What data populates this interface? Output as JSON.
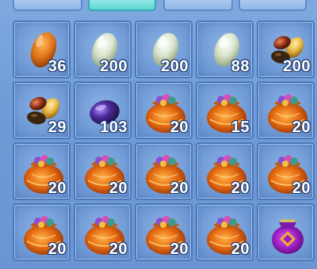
{
  "tabs": [
    {
      "label": "",
      "active": false
    },
    {
      "label": "",
      "active": true
    },
    {
      "label": "",
      "active": false
    },
    {
      "label": "",
      "active": false
    }
  ],
  "inventory": {
    "slots": [
      {
        "icon": "orange-bean-icon",
        "qty": "36"
      },
      {
        "icon": "white-bean-icon",
        "qty": "200"
      },
      {
        "icon": "white-bean-icon",
        "qty": "200"
      },
      {
        "icon": "white-bean-icon",
        "qty": "88"
      },
      {
        "icon": "mixed-beans-icon",
        "qty": "200"
      },
      {
        "icon": "mixed-beans-icon",
        "qty": "29"
      },
      {
        "icon": "purple-bean-icon",
        "qty": "103"
      },
      {
        "icon": "orange-pouch-icon",
        "qty": "20"
      },
      {
        "icon": "orange-pouch-icon",
        "qty": "15"
      },
      {
        "icon": "orange-pouch-icon",
        "qty": "20"
      },
      {
        "icon": "orange-pouch-icon",
        "qty": "20"
      },
      {
        "icon": "orange-pouch-icon",
        "qty": "20"
      },
      {
        "icon": "orange-pouch-icon",
        "qty": "20"
      },
      {
        "icon": "orange-pouch-icon",
        "qty": "20"
      },
      {
        "icon": "orange-pouch-icon",
        "qty": "20"
      },
      {
        "icon": "orange-pouch-icon",
        "qty": "20"
      },
      {
        "icon": "orange-pouch-icon",
        "qty": "20"
      },
      {
        "icon": "orange-pouch-icon",
        "qty": "20"
      },
      {
        "icon": "orange-pouch-icon",
        "qty": "20"
      },
      {
        "icon": "purple-pouch-icon",
        "qty": ""
      }
    ]
  },
  "colors": {
    "panel": "#6f9bd8",
    "slot_border": "#4d78b8",
    "active_tab": "#5fd6d2",
    "qty_text": "#ffffff"
  }
}
